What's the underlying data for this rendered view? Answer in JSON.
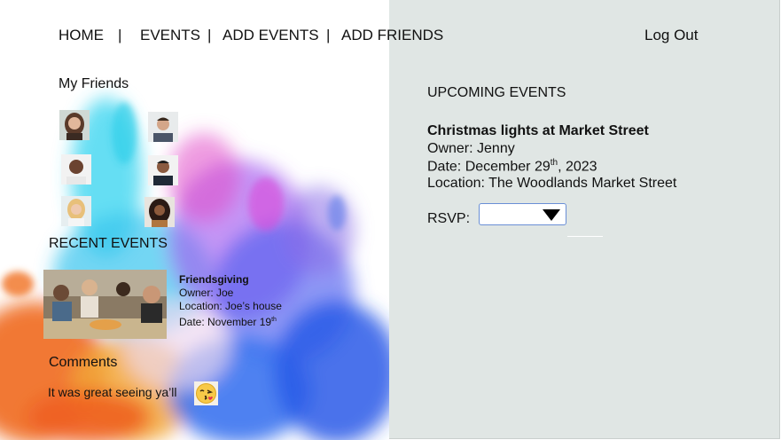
{
  "nav": {
    "home": "HOME",
    "sep": "|",
    "events": "EVENTS",
    "add_events": "ADD EVENTS",
    "add_friends": "ADD FRIENDS",
    "logout": "Log Out"
  },
  "friends": {
    "title": "My Friends",
    "avatars": [
      "friend-1",
      "friend-2",
      "friend-3",
      "friend-4",
      "friend-5",
      "friend-6"
    ]
  },
  "recent": {
    "title": "RECENT EVENTS",
    "event_name": "Friendsgiving",
    "owner": "Owner: Joe",
    "location": "Location: Joe’s house",
    "date": "Date: November 19",
    "date_sup": "th"
  },
  "comments": {
    "title": "Comments",
    "text": "It was great seeing ya’ll",
    "emoji_icon": "kissing-face-icon"
  },
  "upcoming": {
    "title": "UPCOMING EVENTS",
    "event_name": "Christmas lights at Market Street",
    "owner": "Owner: Jenny",
    "date_prefix": "Date: December 29",
    "date_sup": "th",
    "date_suffix": ", 2023",
    "location": "Location: The Woodlands Market Street",
    "rsvp_label": "RSVP:",
    "rsvp_value": ""
  },
  "colors": {
    "right_panel": "#e0e6e4",
    "select_border": "#6a8fd6"
  }
}
